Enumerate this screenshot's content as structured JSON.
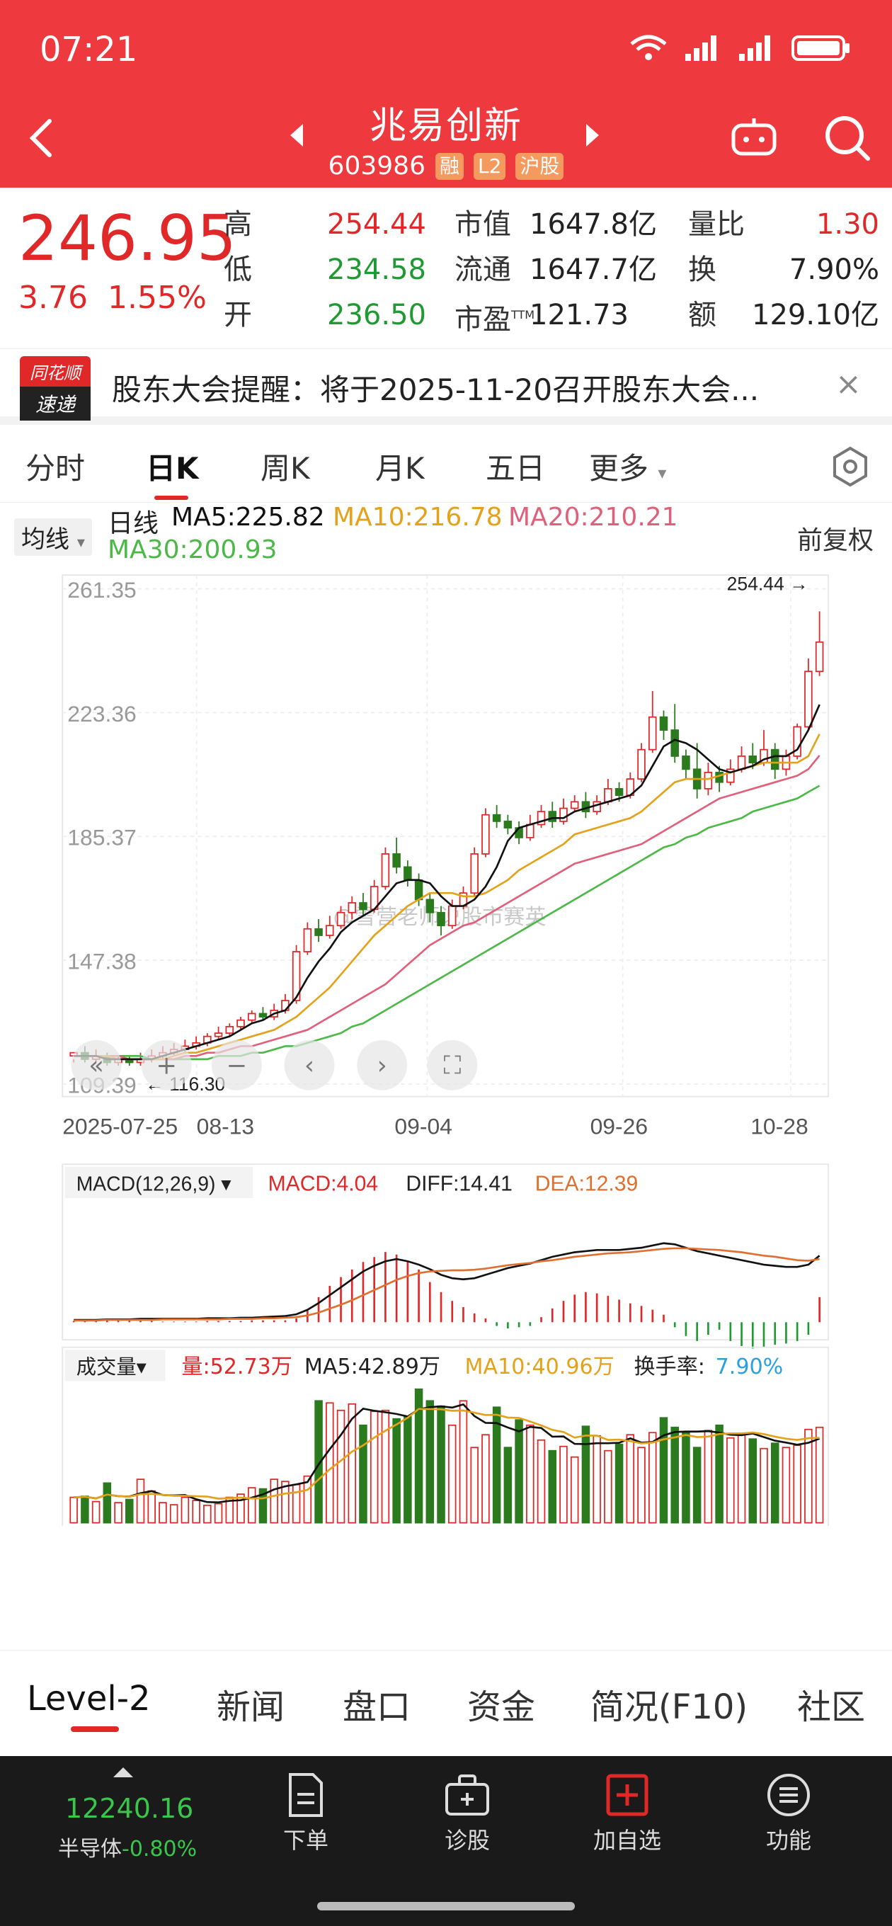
{
  "status": {
    "time": "07:21"
  },
  "header": {
    "name": "兆易创新",
    "code": "603986",
    "tags": [
      "融",
      "L2",
      "沪股"
    ]
  },
  "quote": {
    "price": "246.95",
    "change": "3.76",
    "change_pct": "1.55%",
    "high_label": "高",
    "high": "254.44",
    "low_label": "低",
    "low": "234.58",
    "open_label": "开",
    "open": "236.50",
    "mcap_label": "市值",
    "mcap": "1647.8亿",
    "float_label": "流通",
    "float": "1647.7亿",
    "pe_label": "市盈",
    "pe_sup": "TTM",
    "pe": "121.73",
    "vr_label": "量比",
    "vr": "1.30",
    "turn_label": "换",
    "turn": "7.90%",
    "amt_label": "额",
    "amt": "129.10亿"
  },
  "notice": {
    "logo_top": "同花顺",
    "logo_bottom": "速递",
    "text": "股东大会提醒：将于2025-11-20召开股东大会...",
    "close": "×"
  },
  "tabs": [
    "分时",
    "日K",
    "周K",
    "月K",
    "五日",
    "更多"
  ],
  "legend": {
    "dropdown": "均线",
    "line": "日线",
    "ma5": "MA5:225.82",
    "ma10": "MA10:216.78",
    "ma20": "MA20:210.21",
    "ma30": "MA30:200.93",
    "adjust": "前复权"
  },
  "colors": {
    "up": "#e02828",
    "down": "#2b7a1e",
    "ma5": "#111111",
    "ma10": "#e3a21a",
    "ma20": "#e0607a",
    "ma30": "#4cb848"
  },
  "chart_data": [
    {
      "type": "candlestick",
      "y_ticks": [
        "261.35",
        "223.36",
        "185.37",
        "147.38",
        "109.39"
      ],
      "ylim": [
        109.39,
        261.35
      ],
      "x_ticks": [
        "2025-07-25",
        "08-13",
        "09-04",
        "09-26",
        "10-28"
      ],
      "max_label": "254.44",
      "min_label": "116.30",
      "watermark": "@雪营老师说股市赛英",
      "candles": [
        [
          118,
          119,
          117,
          116
        ],
        [
          119,
          117,
          121,
          116
        ],
        [
          117,
          118,
          120,
          116
        ],
        [
          118,
          116,
          119,
          115
        ],
        [
          116,
          117,
          118,
          115
        ],
        [
          117,
          116,
          118,
          115
        ],
        [
          116,
          117,
          119,
          115
        ],
        [
          117,
          118,
          120,
          116
        ],
        [
          118,
          119,
          121,
          117
        ],
        [
          119,
          120,
          122,
          118
        ],
        [
          120,
          121,
          123,
          119
        ],
        [
          121,
          122,
          124,
          120
        ],
        [
          122,
          124,
          125,
          121
        ],
        [
          124,
          125,
          127,
          123
        ],
        [
          125,
          127,
          128,
          124
        ],
        [
          127,
          129,
          130,
          126
        ],
        [
          129,
          131,
          132,
          128
        ],
        [
          131,
          130,
          133,
          129
        ],
        [
          130,
          132,
          134,
          129
        ],
        [
          132,
          135,
          137,
          131
        ],
        [
          135,
          150,
          152,
          134
        ],
        [
          150,
          157,
          159,
          149
        ],
        [
          157,
          155,
          160,
          153
        ],
        [
          155,
          158,
          161,
          154
        ],
        [
          158,
          162,
          164,
          157
        ],
        [
          162,
          165,
          167,
          160
        ],
        [
          165,
          163,
          168,
          161
        ],
        [
          163,
          170,
          172,
          162
        ],
        [
          170,
          180,
          182,
          169
        ],
        [
          180,
          176,
          185,
          174
        ],
        [
          176,
          172,
          178,
          170
        ],
        [
          172,
          166,
          174,
          164
        ],
        [
          166,
          162,
          168,
          159
        ],
        [
          162,
          158,
          164,
          155
        ],
        [
          158,
          164,
          166,
          157
        ],
        [
          164,
          168,
          170,
          163
        ],
        [
          168,
          180,
          182,
          167
        ],
        [
          180,
          192,
          194,
          179
        ],
        [
          192,
          190,
          195,
          188
        ],
        [
          190,
          188,
          192,
          186
        ],
        [
          188,
          185,
          190,
          183
        ],
        [
          185,
          189,
          192,
          184
        ],
        [
          189,
          193,
          195,
          188
        ],
        [
          193,
          190,
          196,
          188
        ],
        [
          190,
          194,
          197,
          189
        ],
        [
          194,
          196,
          198,
          193
        ],
        [
          196,
          193,
          199,
          191
        ],
        [
          193,
          196,
          198,
          192
        ],
        [
          196,
          200,
          203,
          195
        ],
        [
          200,
          198,
          202,
          196
        ],
        [
          198,
          203,
          205,
          197
        ],
        [
          203,
          212,
          214,
          202
        ],
        [
          212,
          222,
          230,
          211
        ],
        [
          222,
          218,
          224,
          215
        ],
        [
          218,
          210,
          226,
          208
        ],
        [
          210,
          206,
          212,
          203
        ],
        [
          206,
          200,
          214,
          197
        ],
        [
          200,
          205,
          208,
          198
        ],
        [
          205,
          202,
          207,
          199
        ],
        [
          202,
          206,
          209,
          201
        ],
        [
          206,
          210,
          213,
          205
        ],
        [
          210,
          208,
          214,
          206
        ],
        [
          208,
          212,
          218,
          207
        ],
        [
          212,
          206,
          214,
          203
        ],
        [
          206,
          210,
          212,
          204
        ],
        [
          210,
          219,
          220,
          209
        ],
        [
          219,
          236,
          240,
          218
        ],
        [
          236,
          245,
          254.44,
          234.58
        ]
      ],
      "ma5": [
        118,
        118,
        118,
        117,
        117,
        117,
        117,
        117,
        118,
        119,
        120,
        121,
        122,
        123,
        124,
        126,
        128,
        129,
        131,
        132,
        136,
        142,
        147,
        151,
        156,
        159,
        161,
        163,
        167,
        171,
        172,
        172,
        171,
        167,
        164,
        164,
        166,
        170,
        176,
        184,
        188,
        189,
        190,
        191,
        191,
        193,
        194,
        195,
        196,
        197,
        198,
        201,
        207,
        213,
        215,
        214,
        212,
        209,
        206,
        205,
        206,
        207,
        209,
        210,
        210,
        212,
        218,
        225.82
      ],
      "ma10": [
        118,
        118,
        118,
        118,
        117,
        117,
        117,
        117,
        117,
        118,
        119,
        119,
        120,
        121,
        122,
        123,
        124,
        125,
        126,
        128,
        130,
        133,
        136,
        139,
        143,
        147,
        151,
        155,
        158,
        161,
        164,
        166,
        168,
        168,
        168,
        167,
        167,
        168,
        170,
        172,
        175,
        177,
        179,
        181,
        183,
        186,
        187,
        188,
        189,
        190,
        191,
        193,
        196,
        199,
        202,
        203,
        203,
        203,
        204,
        205,
        206,
        207,
        208,
        208,
        208,
        208,
        210,
        216.78
      ],
      "ma20": [
        118,
        118,
        118,
        118,
        118,
        117,
        117,
        117,
        117,
        117,
        118,
        118,
        119,
        119,
        120,
        121,
        121,
        122,
        123,
        124,
        125,
        126,
        128,
        130,
        132,
        134,
        136,
        138,
        140,
        143,
        146,
        149,
        152,
        154,
        156,
        158,
        159,
        161,
        163,
        165,
        167,
        169,
        171,
        173,
        175,
        177,
        178,
        179,
        180,
        181,
        182,
        183,
        185,
        187,
        189,
        191,
        193,
        195,
        197,
        198,
        199,
        200,
        201,
        202,
        203,
        204,
        206,
        210.21
      ],
      "ma30": [
        118,
        118,
        118,
        118,
        118,
        118,
        118,
        117,
        117,
        117,
        117,
        117,
        117,
        118,
        118,
        118,
        119,
        119,
        120,
        121,
        121,
        122,
        123,
        124,
        125,
        127,
        128,
        130,
        132,
        134,
        136,
        138,
        140,
        142,
        144,
        146,
        148,
        150,
        152,
        154,
        156,
        158,
        160,
        162,
        164,
        166,
        168,
        170,
        172,
        174,
        176,
        178,
        180,
        182,
        183,
        185,
        186,
        188,
        189,
        190,
        191,
        193,
        194,
        195,
        196,
        197,
        199,
        200.93
      ]
    },
    {
      "type": "bar",
      "label": "MACD(12,26,9)",
      "macd": "MACD:4.04",
      "diff": "DIFF:14.41",
      "dea": "DEA:12.39"
    },
    {
      "type": "bar",
      "label": "成交量",
      "vol": "量:52.73万",
      "ma5": "MA5:42.89万",
      "ma10": "MA10:40.96万",
      "turnover_label": "换手率:",
      "turnover": "7.90%"
    }
  ],
  "bottom_tabs": [
    "Level-2",
    "新闻",
    "盘口",
    "资金",
    "简况(F10)",
    "社区"
  ],
  "footer": {
    "index_value": "12240.16",
    "index_name": "半导体",
    "index_change": "-0.80%",
    "items": [
      "下单",
      "诊股",
      "加自选",
      "功能"
    ]
  }
}
